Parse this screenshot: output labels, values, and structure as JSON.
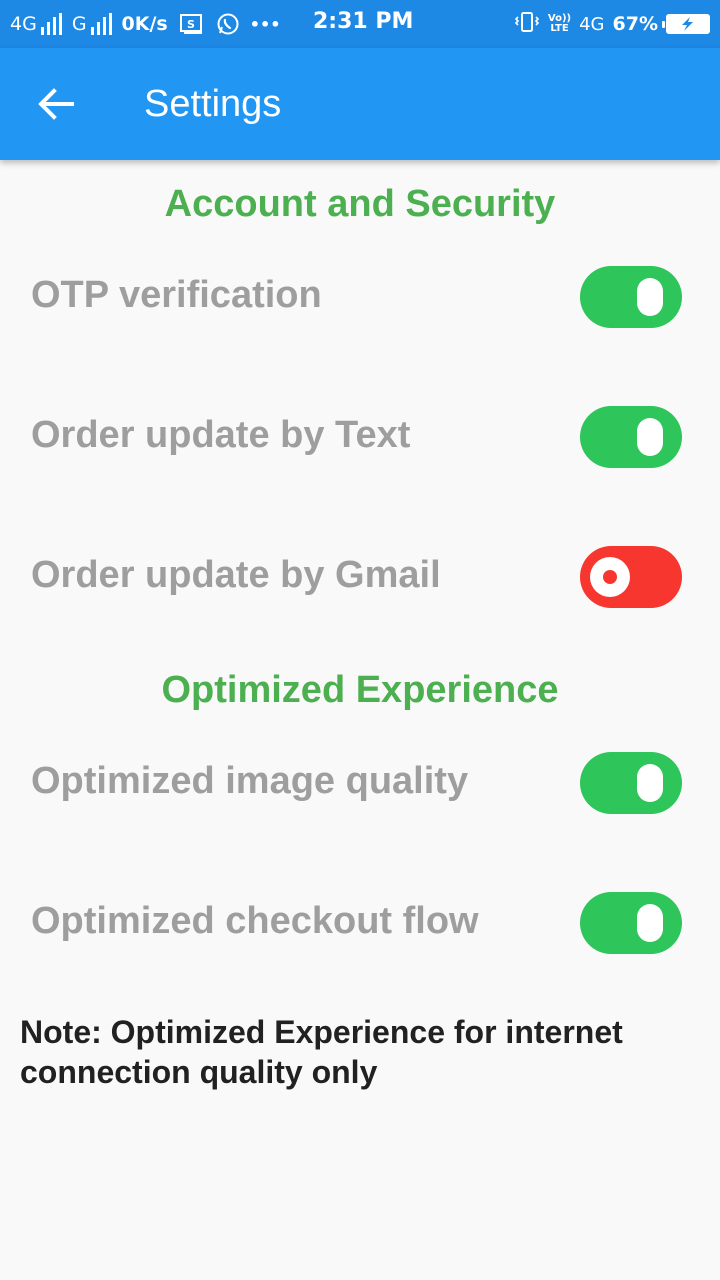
{
  "status_bar": {
    "network1": "4G",
    "network2": "G",
    "speed": "0K/s",
    "screenshot_icon": "screenshot-icon",
    "whatsapp_icon": "whatsapp-icon",
    "more": "•••",
    "time": "2:31 PM",
    "volte_top": "Vo))",
    "volte_bottom": "LTE",
    "network3": "4G",
    "battery_percent": "67%"
  },
  "app_bar": {
    "back_icon": "arrow-back-icon",
    "title": "Settings"
  },
  "sections": [
    {
      "title": "Account and Security",
      "items": [
        {
          "label": "OTP verification",
          "enabled": true
        },
        {
          "label": "Order update by Text",
          "enabled": true
        },
        {
          "label": "Order update by Gmail",
          "enabled": false
        }
      ]
    },
    {
      "title": "Optimized Experience",
      "items": [
        {
          "label": "Optimized image quality",
          "enabled": true
        },
        {
          "label": "Optimized checkout flow",
          "enabled": true
        }
      ]
    }
  ],
  "note": "Note: Optimized Experience for internet connection quality only",
  "colors": {
    "app_bar": "#2196f3",
    "section_title": "#4caf50",
    "toggle_on": "#2ec55a",
    "toggle_off": "#f7372f",
    "label": "#9e9e9e"
  }
}
